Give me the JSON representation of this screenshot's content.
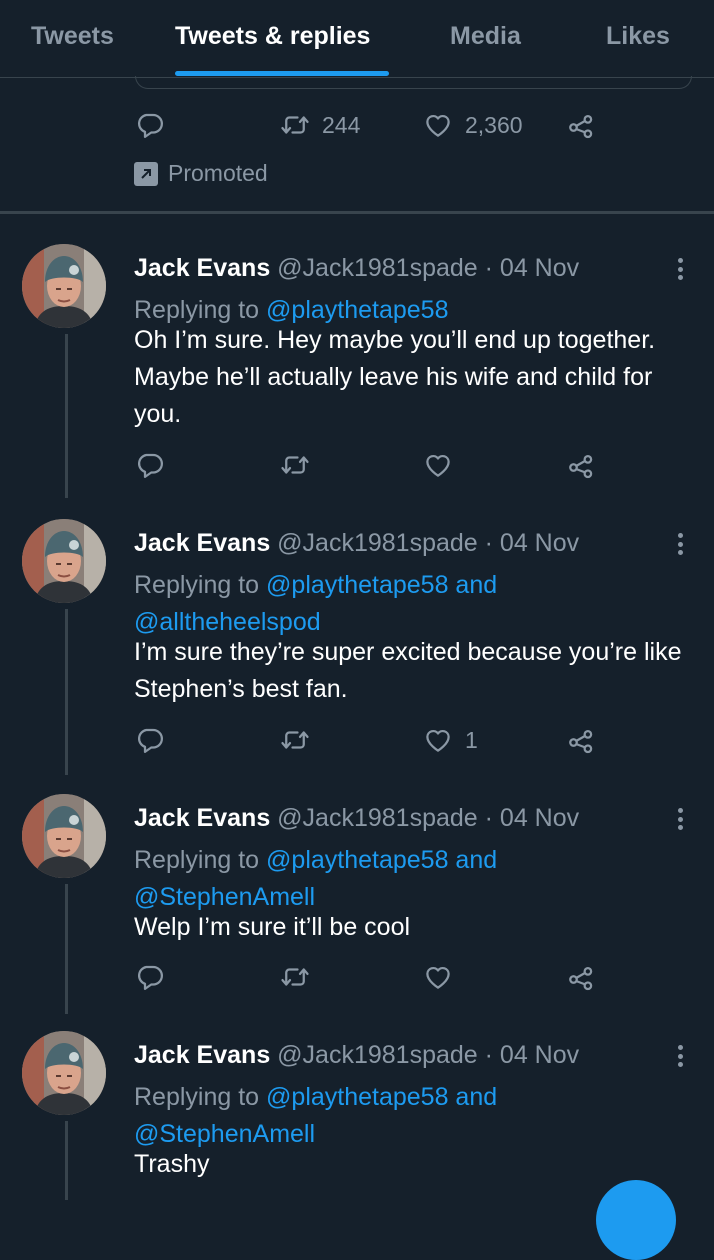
{
  "tabs": [
    "Tweets",
    "Tweets & replies",
    "Media",
    "Likes"
  ],
  "active_tab": "Tweets & replies",
  "promoted_tweet": {
    "retweets": "244",
    "likes": "2,360",
    "promoted_label": "Promoted"
  },
  "tweets": [
    {
      "name": "Jack Evans",
      "handle": "@Jack1981spade",
      "separator": "·",
      "date": "04 Nov",
      "replying_prefix": "Replying to",
      "replying_line1": "@playthetape58",
      "replying_line2": "",
      "text": "Oh I’m sure. Hey maybe you’ll end up together. Maybe he’ll actually leave his wife and child for you.",
      "like_count": ""
    },
    {
      "name": "Jack Evans",
      "handle": "@Jack1981spade",
      "separator": "·",
      "date": "04 Nov",
      "replying_prefix": "Replying to",
      "replying_line1": "@playthetape58 and",
      "replying_line2": "@alltheheelspod",
      "text": "I’m sure they’re super excited because you’re like Stephen’s best fan.",
      "like_count": "1"
    },
    {
      "name": "Jack Evans",
      "handle": "@Jack1981spade",
      "separator": "·",
      "date": "04 Nov",
      "replying_prefix": "Replying to",
      "replying_line1": "@playthetape58 and",
      "replying_line2": "@StephenAmell",
      "text": "Welp I’m sure it’ll be cool",
      "like_count": ""
    },
    {
      "name": "Jack Evans",
      "handle": "@Jack1981spade",
      "separator": "·",
      "date": "04 Nov",
      "replying_prefix": "Replying to",
      "replying_line1": "@playthetape58 and",
      "replying_line2": "@StephenAmell",
      "text": "Trashy",
      "like_count": ""
    }
  ],
  "colors": {
    "background": "#15202b",
    "accent": "#1d9bf0",
    "secondary_text": "#8b98a5",
    "divider": "#38444d"
  },
  "icons": [
    "reply-icon",
    "retweet-icon",
    "like-icon",
    "share-icon",
    "more-icon",
    "promoted-icon"
  ]
}
